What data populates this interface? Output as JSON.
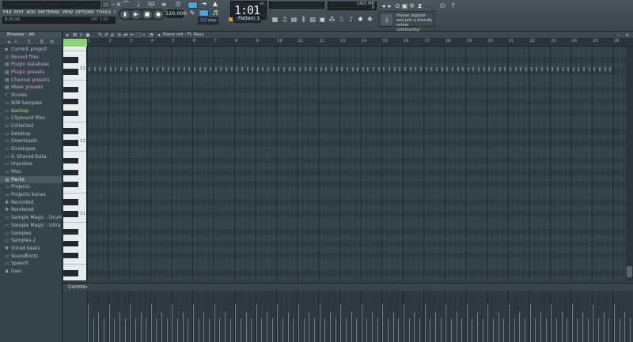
{
  "menu": [
    "FILE",
    "EDIT",
    "ADD",
    "PATTERNS",
    "VIEW",
    "OPTIONS",
    "TOOLS",
    "?"
  ],
  "hint_bar": {
    "left": "8:20:06",
    "right": "PAT 1:00"
  },
  "tempo": "120.000",
  "time_display": "1:01",
  "time_unit": "00",
  "pattern": "Pattern 1",
  "snap": "1/2 step",
  "cpu": {
    "memory": "1425 MB",
    "polyphony": "0"
  },
  "news": "Please register and join a friendly online community!",
  "browser": {
    "title": "Browser - All",
    "items": [
      {
        "label": "Current project",
        "icon": "▪",
        "style": "normal"
      },
      {
        "label": "Recent files",
        "icon": "◷",
        "style": "pinkdim"
      },
      {
        "label": "Plugin database",
        "icon": "▤",
        "style": "purple"
      },
      {
        "label": "Plugin presets",
        "icon": "▤",
        "style": "pink"
      },
      {
        "label": "Channel presets",
        "icon": "▤",
        "style": "pinkdim"
      },
      {
        "label": "Mixer presets",
        "icon": "▤",
        "style": "pinkdim"
      },
      {
        "label": "Scores",
        "icon": "♪",
        "style": "normal"
      },
      {
        "label": "808 Samples",
        "icon": "▭",
        "style": "normal"
      },
      {
        "label": "Backup",
        "icon": "▭",
        "style": "green"
      },
      {
        "label": "Clipboard files",
        "icon": "▭",
        "style": "normal"
      },
      {
        "label": "Collected",
        "icon": "▭",
        "style": "normal"
      },
      {
        "label": "Desktop",
        "icon": "▭",
        "style": "normal"
      },
      {
        "label": "Downloads",
        "icon": "▭",
        "style": "normal"
      },
      {
        "label": "Envelopes",
        "icon": "▭",
        "style": "normal"
      },
      {
        "label": "IL Shared Data",
        "icon": "▭",
        "style": "normal"
      },
      {
        "label": "Impulses",
        "icon": "▭",
        "style": "normal"
      },
      {
        "label": "Misc",
        "icon": "▭",
        "style": "normal"
      },
      {
        "label": "Packs",
        "icon": "▦",
        "style": "selected"
      },
      {
        "label": "Projects",
        "icon": "▭",
        "style": "normal"
      },
      {
        "label": "Projects bones",
        "icon": "▭",
        "style": "normal"
      },
      {
        "label": "Recorded",
        "icon": "✚",
        "style": "normal"
      },
      {
        "label": "Rendered",
        "icon": "✚",
        "style": "normal"
      },
      {
        "label": "Sample Magic - Drum Hits",
        "icon": "▭",
        "style": "normal"
      },
      {
        "label": "Sample Magic - Ultra Trap",
        "icon": "▭",
        "style": "normal"
      },
      {
        "label": "Samples",
        "icon": "▭",
        "style": "normal"
      },
      {
        "label": "Samples 2",
        "icon": "▭",
        "style": "normal"
      },
      {
        "label": "Sliced beats",
        "icon": "✚",
        "style": "normal"
      },
      {
        "label": "Soundfonts",
        "icon": "▭",
        "style": "normal"
      },
      {
        "label": "Speech",
        "icon": "▭",
        "style": "normal"
      },
      {
        "label": "User",
        "icon": "♟",
        "style": "normal"
      }
    ]
  },
  "piano_roll": {
    "title": "Piano roll - FL Keys",
    "bars": [
      "1",
      "2",
      "3",
      "4",
      "5",
      "6",
      "7",
      "8",
      "9",
      "10",
      "11",
      "12",
      "13",
      "14",
      "15",
      "16",
      "17",
      "18",
      "19",
      "20",
      "21",
      "22",
      "23",
      "24",
      "25",
      "26"
    ],
    "octaves": [
      "C3",
      "C2",
      "C1",
      "C0"
    ],
    "control_label": "Control"
  }
}
